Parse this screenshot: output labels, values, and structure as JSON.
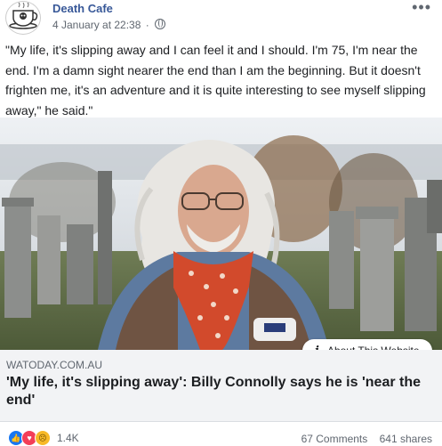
{
  "post": {
    "page_name": "Death Cafe",
    "timestamp": "4 January at 22:38",
    "privacy_icon": "globe-icon",
    "text": "\"My life, it's slipping away and I can feel it and I should. I'm 75, I'm near the end. I'm a damn sight nearer the end than I am the beginning. But it doesn't frighten me, it's an adventure and it is quite interesting to see myself slipping away,\" he said.\""
  },
  "link": {
    "about_label": "About This Website",
    "domain": "WATODAY.COM.AU",
    "headline": "'My life, it's slipping away': Billy Connolly says he is 'near the end'"
  },
  "footer": {
    "reaction_count": "1.4K",
    "comments": "67 Comments",
    "shares": "641 shares"
  },
  "colors": {
    "page_name": "#385898",
    "meta": "#606770",
    "link_box_bg": "#f2f3f5"
  }
}
